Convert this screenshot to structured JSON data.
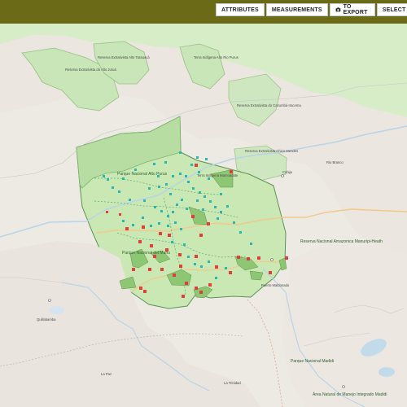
{
  "toolbar": {
    "attributes": "ATTRIBUTES",
    "measurements": "MEASUREMENTS",
    "to_export": "TO EXPORT",
    "select": "SELECT"
  },
  "colors": {
    "topbar": "#6b6b17",
    "land": "#ebe6df",
    "green": "#cfe9b9",
    "ucGreen": "#8ec774",
    "darkGreen": "#5f8f47",
    "red": "#e43b3b",
    "teal": "#2bb6b2",
    "road": "#f5d09a",
    "water": "#b8d4e8"
  },
  "map_labels": {
    "reserva_alto_jurua": "Reserva Extrativista do Alto Juruá",
    "alto_tarauaca": "Reserva Extrativista Alto Tarauacá",
    "terra_indigena_alto": "Terra Indígena Alto Rio Purus",
    "parque_alto_purus": "Parque Nacional Alto Purus",
    "reserva_chico_mendes": "Reserva Extrativista Chico Mendes",
    "reserva_cazumba": "Reserva Extrativista do Cazumbá-Iracema",
    "terra_indigena_mamoadate": "Terra Indígena Mamoadate",
    "reserva_amazonica": "Reserva Nacional Amazonica Manuripi-Heath",
    "parque_manu": "Parque Nacional del Manu",
    "quillabamba": "Quillabamba",
    "rio_branco": "Rio Branco",
    "parque_madidi": "Parque Nacional Madidi",
    "area_natural": "Área Natural de Manejo Integrado Madidi",
    "cobija": "Cobija",
    "puerto_maldonado": "Puerto Maldonado",
    "la_paz_area": "La Paz",
    "la_trinidad": "La Trinidad"
  },
  "stats": {
    "red_points": 36,
    "teal_points": 62
  }
}
